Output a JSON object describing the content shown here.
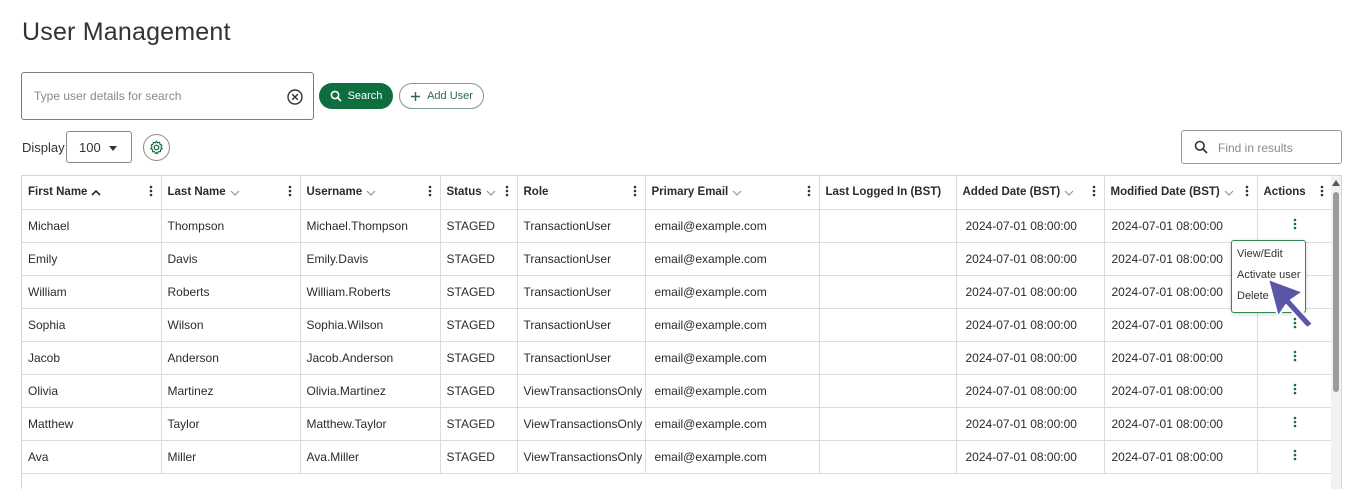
{
  "page": {
    "title": "User Management"
  },
  "search": {
    "placeholder": "Type user details for search",
    "search_button": "Search",
    "add_user_button": "Add User"
  },
  "display": {
    "label": "Display",
    "value": "100"
  },
  "find": {
    "placeholder": "Find in results"
  },
  "colors": {
    "primary": "#0f6e3f",
    "accent_border": "#2d8a55",
    "cursor": "#5b57a6"
  },
  "table": {
    "columns": [
      "First Name",
      "Last Name",
      "Username",
      "Status",
      "Role",
      "Primary Email",
      "Last Logged In (BST)",
      "Added Date (BST)",
      "Modified Date (BST)",
      "Actions"
    ],
    "rows": [
      {
        "first": "Michael",
        "last": "Thompson",
        "username": "Michael.Thompson",
        "status": "STAGED",
        "role": "TransactionUser",
        "email": "email@example.com",
        "last_login": "",
        "added": "2024-07-01 08:00:00",
        "modified": "2024-07-01 08:00:00"
      },
      {
        "first": "Emily",
        "last": "Davis",
        "username": "Emily.Davis",
        "status": "STAGED",
        "role": "TransactionUser",
        "email": "email@example.com",
        "last_login": "",
        "added": "2024-07-01 08:00:00",
        "modified": "2024-07-01 08:00:00"
      },
      {
        "first": "William",
        "last": "Roberts",
        "username": "William.Roberts",
        "status": "STAGED",
        "role": "TransactionUser",
        "email": "email@example.com",
        "last_login": "",
        "added": "2024-07-01 08:00:00",
        "modified": "2024-07-01 08:00:00"
      },
      {
        "first": "Sophia",
        "last": "Wilson",
        "username": "Sophia.Wilson",
        "status": "STAGED",
        "role": "TransactionUser",
        "email": "email@example.com",
        "last_login": "",
        "added": "2024-07-01 08:00:00",
        "modified": "2024-07-01 08:00:00"
      },
      {
        "first": "Jacob",
        "last": "Anderson",
        "username": "Jacob.Anderson",
        "status": "STAGED",
        "role": "TransactionUser",
        "email": "email@example.com",
        "last_login": "",
        "added": "2024-07-01 08:00:00",
        "modified": "2024-07-01 08:00:00"
      },
      {
        "first": "Olivia",
        "last": "Martinez",
        "username": "Olivia.Martinez",
        "status": "STAGED",
        "role": "ViewTransactionsOnly",
        "email": "email@example.com",
        "last_login": "",
        "added": "2024-07-01 08:00:00",
        "modified": "2024-07-01 08:00:00"
      },
      {
        "first": "Matthew",
        "last": "Taylor",
        "username": "Matthew.Taylor",
        "status": "STAGED",
        "role": "ViewTransactionsOnly",
        "email": "email@example.com",
        "last_login": "",
        "added": "2024-07-01 08:00:00",
        "modified": "2024-07-01 08:00:00"
      },
      {
        "first": "Ava",
        "last": "Miller",
        "username": "Ava.Miller",
        "status": "STAGED",
        "role": "ViewTransactionsOnly",
        "email": "email@example.com",
        "last_login": "",
        "added": "2024-07-01 08:00:00",
        "modified": "2024-07-01 08:00:00"
      }
    ]
  },
  "row_menu": {
    "items": [
      "View/Edit",
      "Activate user",
      "Delete"
    ]
  }
}
